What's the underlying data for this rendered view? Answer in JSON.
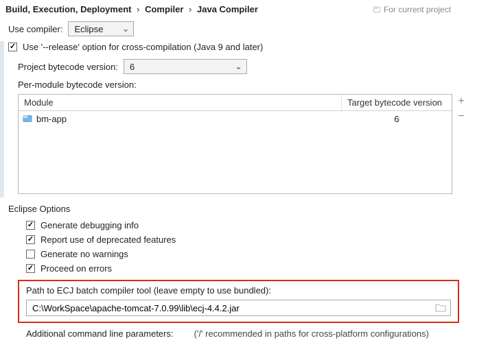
{
  "breadcrumb": {
    "root": "Build, Execution, Deployment",
    "mid": "Compiler",
    "leaf": "Java Compiler"
  },
  "hint": "For current project",
  "compiler": {
    "label": "Use compiler:",
    "value": "Eclipse"
  },
  "releaseOption": {
    "label": "Use '--release' option for cross-compilation (Java 9 and later)",
    "checked": true
  },
  "projectBytecode": {
    "label": "Project bytecode version:",
    "value": "6"
  },
  "perModule": {
    "label": "Per-module bytecode version:",
    "headers": {
      "module": "Module",
      "target": "Target bytecode version"
    },
    "rows": [
      {
        "name": "bm-app",
        "target": "6"
      }
    ]
  },
  "eclipseOptions": {
    "title": "Eclipse Options",
    "items": [
      {
        "label": "Generate debugging info",
        "checked": true
      },
      {
        "label": "Report use of deprecated features",
        "checked": true
      },
      {
        "label": "Generate no warnings",
        "checked": false
      },
      {
        "label": "Proceed on errors",
        "checked": true
      }
    ]
  },
  "ecj": {
    "label": "Path to ECJ batch compiler tool (leave empty to use bundled):",
    "value": "C:\\WorkSpace\\apache-tomcat-7.0.99\\lib\\ecj-4.4.2.jar"
  },
  "additionalParams": {
    "label": "Additional command line parameters:",
    "hint": "('/' recommended in paths for cross-platform configurations)"
  }
}
